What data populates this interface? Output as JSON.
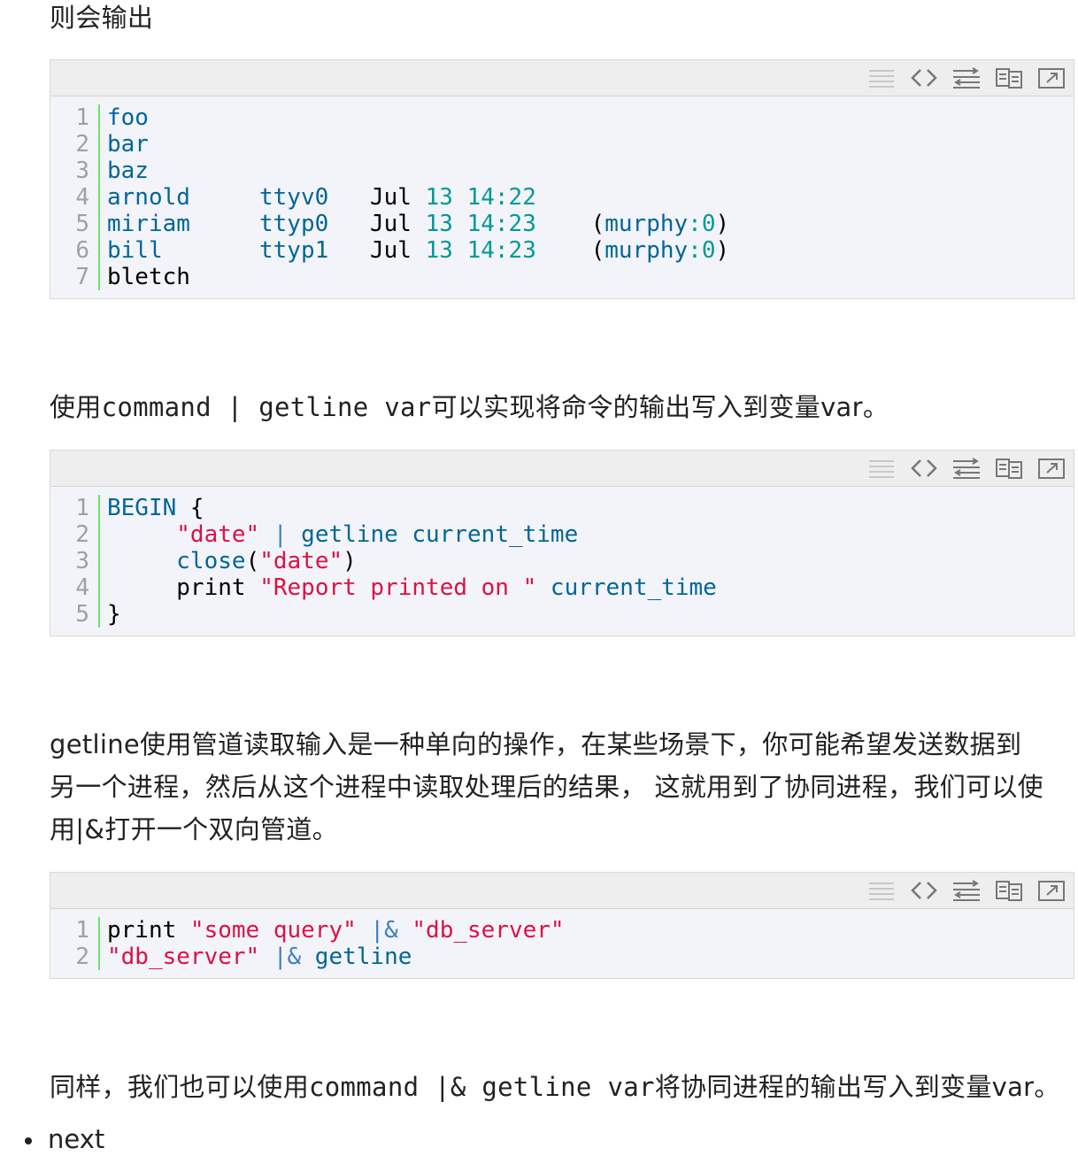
{
  "paragraphs": {
    "p1": "则会输出",
    "p2_pre": "使用",
    "p2_code": "command | getline var",
    "p2_post": "可以实现将命令的输出写入到变量var。",
    "p3_line1": "getline使用管道读取输入是一种单向的操作，在某些场景下，你可能希望发送数据到",
    "p3_line2": "另一个进程，然后从这个进程中读取处理后的结果， 这就用到了协同进程，我们可以使",
    "p3_line3": "用|&打开一个双向管道。",
    "p4_pre": "同样，我们也可以使用",
    "p4_code": "command |& getline var",
    "p4_post": "将协同进程的输出写入到变量var。"
  },
  "toolbar_icons": [
    "view-source-icon",
    "toggle-plain-icon",
    "wrap-lines-icon",
    "copy-icon",
    "popup-icon"
  ],
  "code1": {
    "line_numbers": [
      "1",
      "2",
      "3",
      "4",
      "5",
      "6",
      "7"
    ],
    "lines": [
      {
        "c1": "foo"
      },
      {
        "c1": "bar"
      },
      {
        "c1": "baz"
      },
      {
        "c1": "arnold",
        "c2": "ttyv0",
        "c3": "Jul",
        "c4": "13",
        "c5": "14:22"
      },
      {
        "c1": "miriam",
        "c2": "ttyp0",
        "c3": "Jul",
        "c4": "13",
        "c5": "14:23",
        "c6a": "(",
        "c6b": "murphy",
        "c6c": ":0",
        "c6d": ")"
      },
      {
        "c1": "bill",
        "c2": "ttyp1",
        "c3": "Jul",
        "c4": "13",
        "c5": "14:23",
        "c6a": "(",
        "c6b": "murphy",
        "c6c": ":0",
        "c6d": ")"
      },
      {
        "c1": "bletch"
      }
    ]
  },
  "code2": {
    "line_numbers": [
      "1",
      "2",
      "3",
      "4",
      "5"
    ],
    "l1a": "BEGIN",
    "l1b": " {",
    "l2a": "\"date\"",
    "l2b": " | ",
    "l2c": "getline current_time",
    "l3a": "close",
    "l3b": "(",
    "l3c": "\"date\"",
    "l3d": ")",
    "l4a": "print ",
    "l4b": "\"Report printed on \"",
    "l4c": " current_time",
    "l5a": "}"
  },
  "code3": {
    "line_numbers": [
      "1",
      "2"
    ],
    "l1a": "print ",
    "l1b": "\"some query\"",
    "l1c": " |&",
    "l1d": " ",
    "l1e": "\"db_server\"",
    "l2a": "\"db_server\"",
    "l2b": " |&",
    "l2c": " getline"
  },
  "list": {
    "item1": "next"
  }
}
